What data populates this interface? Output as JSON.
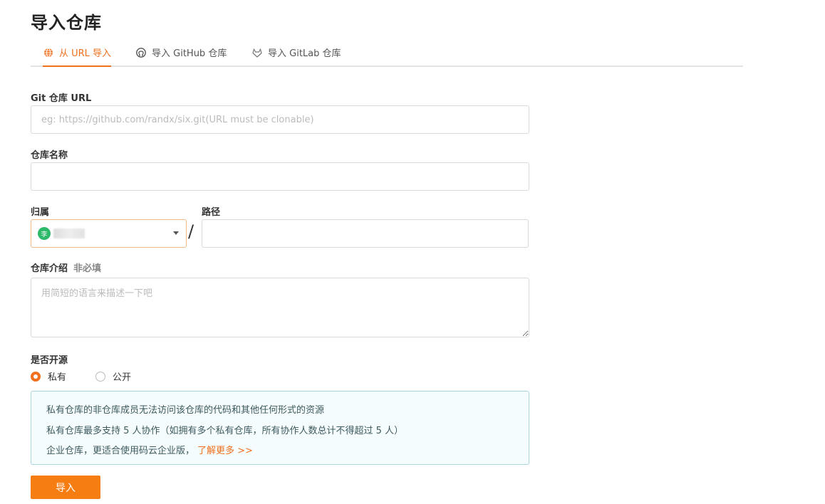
{
  "page": {
    "title": "导入仓库"
  },
  "tabs": [
    {
      "label": "从 URL 导入",
      "icon": "globe-icon",
      "active": true
    },
    {
      "label": "导入 GitHub 仓库",
      "icon": "github-icon",
      "active": false
    },
    {
      "label": "导入 GitLab 仓库",
      "icon": "gitlab-icon",
      "active": false
    }
  ],
  "form": {
    "url": {
      "label": "Git 仓库 URL",
      "placeholder": "eg: https://github.com/randx/six.git(URL must be clonable)",
      "value": ""
    },
    "name": {
      "label": "仓库名称",
      "value": ""
    },
    "owner": {
      "label": "归属",
      "avatar_text": "李",
      "value": ""
    },
    "separator": "/",
    "path": {
      "label": "路径",
      "value": ""
    },
    "description": {
      "label": "仓库介绍",
      "optional": "非必填",
      "placeholder": "用简短的语言来描述一下吧",
      "value": ""
    },
    "visibility": {
      "label": "是否开源",
      "options": [
        {
          "label": "私有",
          "selected": true
        },
        {
          "label": "公开",
          "selected": false
        }
      ]
    }
  },
  "notice": {
    "lines": [
      "私有仓库的非仓库成员无法访问该仓库的代码和其他任何形式的资源",
      "私有仓库最多支持 5 人协作（如拥有多个私有仓库，所有协作人数总计不得超过 5 人）",
      "企业仓库，更适合使用码云企业版，"
    ],
    "link": "了解更多 >>"
  },
  "submit_label": "导入",
  "colors": {
    "accent": "#f0701e",
    "button": "#f57d12",
    "notice_border": "#a8d6de",
    "notice_bg": "#f5fcfd",
    "avatar": "#2db86a"
  }
}
